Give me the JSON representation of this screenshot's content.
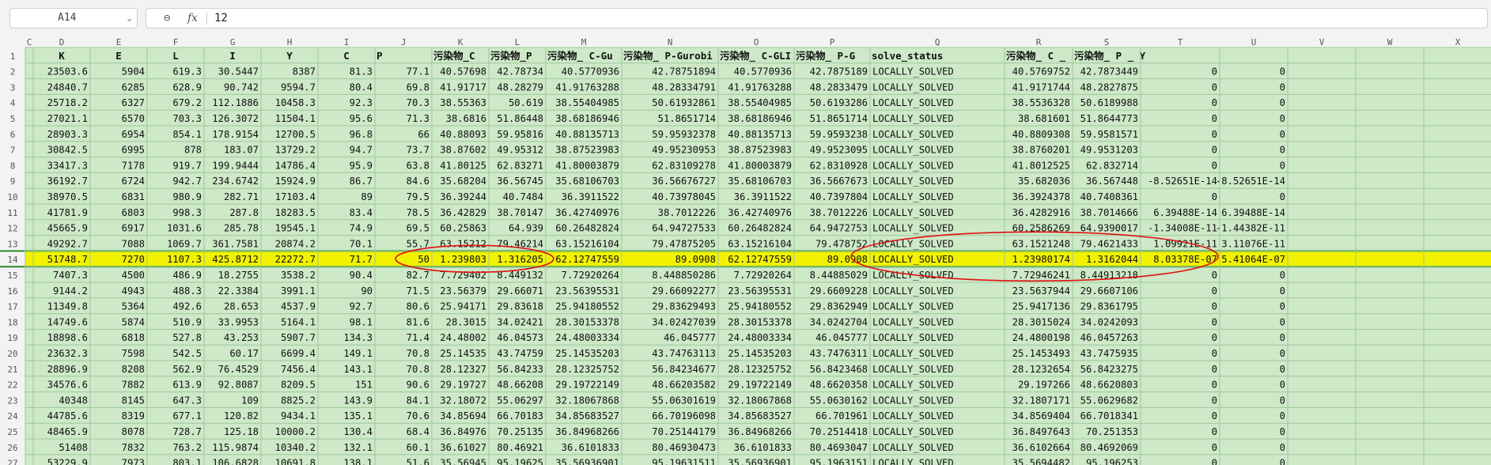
{
  "formula_bar": {
    "name_box": "A14",
    "name_box_caret": "⌄",
    "zoom_icon": "magnifier-icon",
    "zoom_glyph": "⊖",
    "fx_label": "fx",
    "formula": "12"
  },
  "colors": {
    "data_fill": "#cde9c8",
    "selected_row_fill": "#f2f200",
    "grid": "#9fc79a",
    "header_bg": "#f3f3f3",
    "header_text": "#555555",
    "row_border": "#2a8a2a",
    "annotation": "#e01010"
  },
  "sheet": {
    "column_letters": [
      "C",
      "D",
      "E",
      "F",
      "G",
      "H",
      "I",
      "J",
      "K",
      "L",
      "M",
      "N",
      "O",
      "P",
      "Q",
      "R",
      "S",
      "T",
      "U",
      "V",
      "W",
      "X"
    ],
    "row_numbers": [
      "1",
      "2",
      "3",
      "4",
      "5",
      "6",
      "7",
      "8",
      "9",
      "10",
      "11",
      "12",
      "13",
      "14",
      "15",
      "16",
      "17",
      "18",
      "19",
      "20",
      "21",
      "22",
      "23",
      "24",
      "25",
      "26",
      "27"
    ],
    "selected_row": "14",
    "header_row": [
      "",
      "K",
      "E",
      "L",
      "I",
      "Y",
      "C",
      "P",
      "污染物_C",
      "污染物_P",
      "污染物_ C-Gu",
      "污染物_ P-Gurobi",
      "污染物_ C-GLI",
      "污染物_ P-G",
      "solve_status",
      "污染物_ C _",
      "污染物_ P _ Y",
      "",
      "",
      "",
      "",
      ""
    ],
    "rows": [
      [
        "",
        "23503.6",
        "5904",
        "619.3",
        "30.5447",
        "8387",
        "81.3",
        "77.1",
        "40.57698",
        "42.78734",
        "40.5770936",
        "42.78751894",
        "40.5770936",
        "42.7875189",
        "LOCALLY_SOLVED",
        "40.5769752",
        "42.7873449",
        "0",
        "0",
        "",
        "",
        ""
      ],
      [
        "",
        "24840.7",
        "6285",
        "628.9",
        "90.742",
        "9594.7",
        "80.4",
        "69.8",
        "41.91717",
        "48.28279",
        "41.91763288",
        "48.28334791",
        "41.91763288",
        "48.2833479",
        "LOCALLY_SOLVED",
        "41.9171744",
        "48.2827875",
        "0",
        "0",
        "",
        "",
        ""
      ],
      [
        "",
        "25718.2",
        "6327",
        "679.2",
        "112.1886",
        "10458.3",
        "92.3",
        "70.3",
        "38.55363",
        "50.619",
        "38.55404985",
        "50.61932861",
        "38.55404985",
        "50.6193286",
        "LOCALLY_SOLVED",
        "38.5536328",
        "50.6189988",
        "0",
        "0",
        "",
        "",
        ""
      ],
      [
        "",
        "27021.1",
        "6570",
        "703.3",
        "126.3072",
        "11504.1",
        "95.6",
        "71.3",
        "38.6816",
        "51.86448",
        "38.68186946",
        "51.8651714",
        "38.68186946",
        "51.8651714",
        "LOCALLY_SOLVED",
        "38.681601",
        "51.8644773",
        "0",
        "0",
        "",
        "",
        ""
      ],
      [
        "",
        "28903.3",
        "6954",
        "854.1",
        "178.9154",
        "12700.5",
        "96.8",
        "66",
        "40.88093",
        "59.95816",
        "40.88135713",
        "59.95932378",
        "40.88135713",
        "59.9593238",
        "LOCALLY_SOLVED",
        "40.8809308",
        "59.9581571",
        "0",
        "0",
        "",
        "",
        ""
      ],
      [
        "",
        "30842.5",
        "6995",
        "878",
        "183.07",
        "13729.2",
        "94.7",
        "73.7",
        "38.87602",
        "49.95312",
        "38.87523983",
        "49.95230953",
        "38.87523983",
        "49.9523095",
        "LOCALLY_SOLVED",
        "38.8760201",
        "49.9531203",
        "0",
        "0",
        "",
        "",
        ""
      ],
      [
        "",
        "33417.3",
        "7178",
        "919.7",
        "199.9444",
        "14786.4",
        "95.9",
        "63.8",
        "41.80125",
        "62.83271",
        "41.80003879",
        "62.83109278",
        "41.80003879",
        "62.8310928",
        "LOCALLY_SOLVED",
        "41.8012525",
        "62.832714",
        "0",
        "0",
        "",
        "",
        ""
      ],
      [
        "",
        "36192.7",
        "6724",
        "942.7",
        "234.6742",
        "15924.9",
        "86.7",
        "84.6",
        "35.68204",
        "36.56745",
        "35.68106703",
        "36.56676727",
        "35.68106703",
        "36.5667673",
        "LOCALLY_SOLVED",
        "35.682036",
        "36.567448",
        "-8.52651E-14",
        "-8.52651E-14",
        "",
        "",
        ""
      ],
      [
        "",
        "38970.5",
        "6831",
        "980.9",
        "282.71",
        "17103.4",
        "89",
        "79.5",
        "36.39244",
        "40.7484",
        "36.3911522",
        "40.73978045",
        "36.3911522",
        "40.7397804",
        "LOCALLY_SOLVED",
        "36.3924378",
        "40.7408361",
        "0",
        "0",
        "",
        "",
        ""
      ],
      [
        "",
        "41781.9",
        "6803",
        "998.3",
        "287.8",
        "18283.5",
        "83.4",
        "78.5",
        "36.42829",
        "38.70147",
        "36.42740976",
        "38.7012226",
        "36.42740976",
        "38.7012226",
        "LOCALLY_SOLVED",
        "36.4282916",
        "38.7014666",
        "6.39488E-14",
        "6.39488E-14",
        "",
        "",
        ""
      ],
      [
        "",
        "45665.9",
        "6917",
        "1031.6",
        "285.78",
        "19545.1",
        "74.9",
        "69.5",
        "60.25863",
        "64.939",
        "60.26482824",
        "64.94727533",
        "60.26482824",
        "64.9472753",
        "LOCALLY_SOLVED",
        "60.2586269",
        "64.9390017",
        "-1.34008E-11",
        "-1.44382E-11",
        "",
        "",
        ""
      ],
      [
        "",
        "49292.7",
        "7088",
        "1069.7",
        "361.7581",
        "20874.2",
        "70.1",
        "55.7",
        "63.15212",
        "79.46214",
        "63.15216104",
        "79.47875205",
        "63.15216104",
        "79.478752",
        "LOCALLY_SOLVED",
        "63.1521248",
        "79.4621433",
        "1.09921E-11",
        "3.11076E-11",
        "",
        "",
        ""
      ],
      [
        "",
        "51748.7",
        "7270",
        "1107.3",
        "425.8712",
        "22272.7",
        "71.7",
        "50",
        "1.239803",
        "1.316205",
        "62.12747559",
        "89.0908",
        "62.12747559",
        "89.0908",
        "LOCALLY_SOLVED",
        "1.23980174",
        "1.3162044",
        "8.03378E-07",
        "5.41064E-07",
        "",
        "",
        ""
      ],
      [
        "",
        "7407.3",
        "4500",
        "486.9",
        "18.2755",
        "3538.2",
        "90.4",
        "82.7",
        "7.729402",
        "8.449132",
        "7.72920264",
        "8.448850286",
        "7.72920264",
        "8.44885029",
        "LOCALLY_SOLVED",
        "7.72946241",
        "8.44913218",
        "0",
        "0",
        "",
        "",
        ""
      ],
      [
        "",
        "9144.2",
        "4943",
        "488.3",
        "22.3384",
        "3991.1",
        "90",
        "71.5",
        "23.56379",
        "29.66071",
        "23.56395531",
        "29.66092277",
        "23.56395531",
        "29.6609228",
        "LOCALLY_SOLVED",
        "23.5637944",
        "29.6607106",
        "0",
        "0",
        "",
        "",
        ""
      ],
      [
        "",
        "11349.8",
        "5364",
        "492.6",
        "28.653",
        "4537.9",
        "92.7",
        "80.6",
        "25.94171",
        "29.83618",
        "25.94180552",
        "29.83629493",
        "25.94180552",
        "29.8362949",
        "LOCALLY_SOLVED",
        "25.9417136",
        "29.8361795",
        "0",
        "0",
        "",
        "",
        ""
      ],
      [
        "",
        "14749.6",
        "5874",
        "510.9",
        "33.9953",
        "5164.1",
        "98.1",
        "81.6",
        "28.3015",
        "34.02421",
        "28.30153378",
        "34.02427039",
        "28.30153378",
        "34.0242704",
        "LOCALLY_SOLVED",
        "28.3015024",
        "34.0242093",
        "0",
        "0",
        "",
        "",
        ""
      ],
      [
        "",
        "18898.6",
        "6818",
        "527.8",
        "43.253",
        "5907.7",
        "134.3",
        "71.4",
        "24.48002",
        "46.04573",
        "24.48003334",
        "46.045777",
        "24.48003334",
        "46.045777",
        "LOCALLY_SOLVED",
        "24.4800198",
        "46.0457263",
        "0",
        "0",
        "",
        "",
        ""
      ],
      [
        "",
        "23632.3",
        "7598",
        "542.5",
        "60.17",
        "6699.4",
        "149.1",
        "70.8",
        "25.14535",
        "43.74759",
        "25.14535203",
        "43.74763113",
        "25.14535203",
        "43.7476311",
        "LOCALLY_SOLVED",
        "25.1453493",
        "43.7475935",
        "0",
        "0",
        "",
        "",
        ""
      ],
      [
        "",
        "28896.9",
        "8208",
        "562.9",
        "76.4529",
        "7456.4",
        "143.1",
        "70.8",
        "28.12327",
        "56.84233",
        "28.12325752",
        "56.84234677",
        "28.12325752",
        "56.8423468",
        "LOCALLY_SOLVED",
        "28.1232654",
        "56.8423275",
        "0",
        "0",
        "",
        "",
        ""
      ],
      [
        "",
        "34576.6",
        "7882",
        "613.9",
        "92.8087",
        "8209.5",
        "151",
        "90.6",
        "29.19727",
        "48.66208",
        "29.19722149",
        "48.66203582",
        "29.19722149",
        "48.6620358",
        "LOCALLY_SOLVED",
        "29.197266",
        "48.6620803",
        "0",
        "0",
        "",
        "",
        ""
      ],
      [
        "",
        "40348",
        "8145",
        "647.3",
        "109",
        "8825.2",
        "143.9",
        "84.1",
        "32.18072",
        "55.06297",
        "32.18067868",
        "55.06301619",
        "32.18067868",
        "55.0630162",
        "LOCALLY_SOLVED",
        "32.1807171",
        "55.0629682",
        "0",
        "0",
        "",
        "",
        ""
      ],
      [
        "",
        "44785.6",
        "8319",
        "677.1",
        "120.82",
        "9434.1",
        "135.1",
        "70.6",
        "34.85694",
        "66.70183",
        "34.85683527",
        "66.70196098",
        "34.85683527",
        "66.701961",
        "LOCALLY_SOLVED",
        "34.8569404",
        "66.7018341",
        "0",
        "0",
        "",
        "",
        ""
      ],
      [
        "",
        "48465.9",
        "8078",
        "728.7",
        "125.18",
        "10000.2",
        "130.4",
        "68.4",
        "36.84976",
        "70.25135",
        "36.84968266",
        "70.25144179",
        "36.84968266",
        "70.2514418",
        "LOCALLY_SOLVED",
        "36.8497643",
        "70.251353",
        "0",
        "0",
        "",
        "",
        ""
      ],
      [
        "",
        "51408",
        "7832",
        "763.2",
        "115.9874",
        "10340.2",
        "132.1",
        "60.1",
        "36.61027",
        "80.46921",
        "36.6101833",
        "80.46930473",
        "36.6101833",
        "80.4693047",
        "LOCALLY_SOLVED",
        "36.6102664",
        "80.4692069",
        "0",
        "0",
        "",
        "",
        ""
      ],
      [
        "",
        "53229.9",
        "7973",
        "803.1",
        "106.6828",
        "10691.8",
        "138.1",
        "51.6",
        "35.56945",
        "95.19625",
        "35.56936901",
        "95.19631511",
        "35.56936901",
        "95.1963151",
        "LOCALLY_SOLVED",
        "35.5694482",
        "95.196253",
        "0",
        "0",
        "",
        "",
        ""
      ]
    ]
  }
}
